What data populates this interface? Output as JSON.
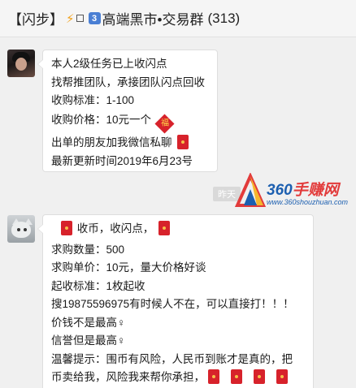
{
  "header": {
    "title_prefix": "【闪步】",
    "bolt": "⚡",
    "keycap": "3",
    "group_name": "高端黑市•交易群",
    "member_count": "(313)"
  },
  "messages": [
    {
      "lines": [
        "本人2级任务已上收闪点",
        "找帮推团队，承接团队闪点回收",
        "收购标准：1-100",
        "收购价格：10元一个",
        "出单的朋友加我微信私聊",
        "最新更新时间2019年6月23号"
      ],
      "fu_char": "福"
    },
    {
      "lines": [
        "收币，收闪点，",
        "求购数量：500",
        "求购单价：10元，量大价格好谈",
        "起收标准：1枚起收",
        "搜19875596975有时候人不在，可以直接打！！！",
        "价钱不是最高♀",
        "信誉但是最高♀",
        "温馨提示：围币有风险，人民币到账才是真的，把",
        "币卖给我，风险我来帮你承担，"
      ]
    }
  ],
  "time_badge": "昨天",
  "watermark": {
    "brand_num": "360",
    "brand_text": "手赚网",
    "url": "www.360shouzhuan.com"
  }
}
